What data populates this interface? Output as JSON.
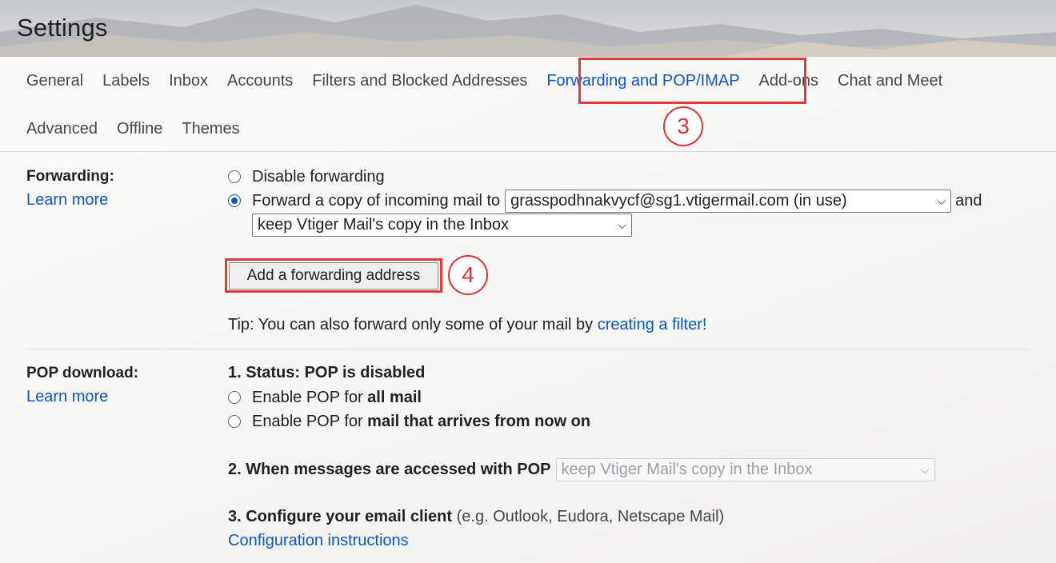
{
  "page": {
    "title": "Settings"
  },
  "tabs": {
    "row1": [
      "General",
      "Labels",
      "Inbox",
      "Accounts",
      "Filters and Blocked Addresses",
      "Forwarding and POP/IMAP",
      "Add-ons",
      "Chat and Meet"
    ],
    "row2": [
      "Advanced",
      "Offline",
      "Themes"
    ],
    "active": "Forwarding and POP/IMAP"
  },
  "callouts": {
    "tab_step": "3",
    "button_step": "4"
  },
  "forwarding": {
    "label": "Forwarding:",
    "learn_more": "Learn more",
    "disable_label": "Disable forwarding",
    "forward_label": "Forward a copy of incoming mail to",
    "forward_address": "grasspodhnakvycf@sg1.vtigermail.com (in use)",
    "and_text": "and",
    "copy_option": "keep Vtiger Mail's copy in the Inbox",
    "add_button": "Add a forwarding address",
    "tip_prefix": "Tip: You can also forward only some of your mail by ",
    "tip_link": "creating a filter!"
  },
  "pop": {
    "label": "POP download:",
    "learn_more": "Learn more",
    "status": "1. Status: POP is disabled",
    "enable_all_prefix": "Enable POP for ",
    "enable_all_bold": "all mail",
    "enable_now_prefix": "Enable POP for ",
    "enable_now_bold": "mail that arrives from now on",
    "when_accessed": "2. When messages are accessed with POP",
    "when_option": "keep Vtiger Mail's copy in the Inbox",
    "configure_bold": "3. Configure your email client",
    "configure_rest": " (e.g. Outlook, Eudora, Netscape Mail)",
    "config_link": "Configuration instructions"
  },
  "colors": {
    "accent": "#0b57d0",
    "highlight": "#e03a3a"
  }
}
